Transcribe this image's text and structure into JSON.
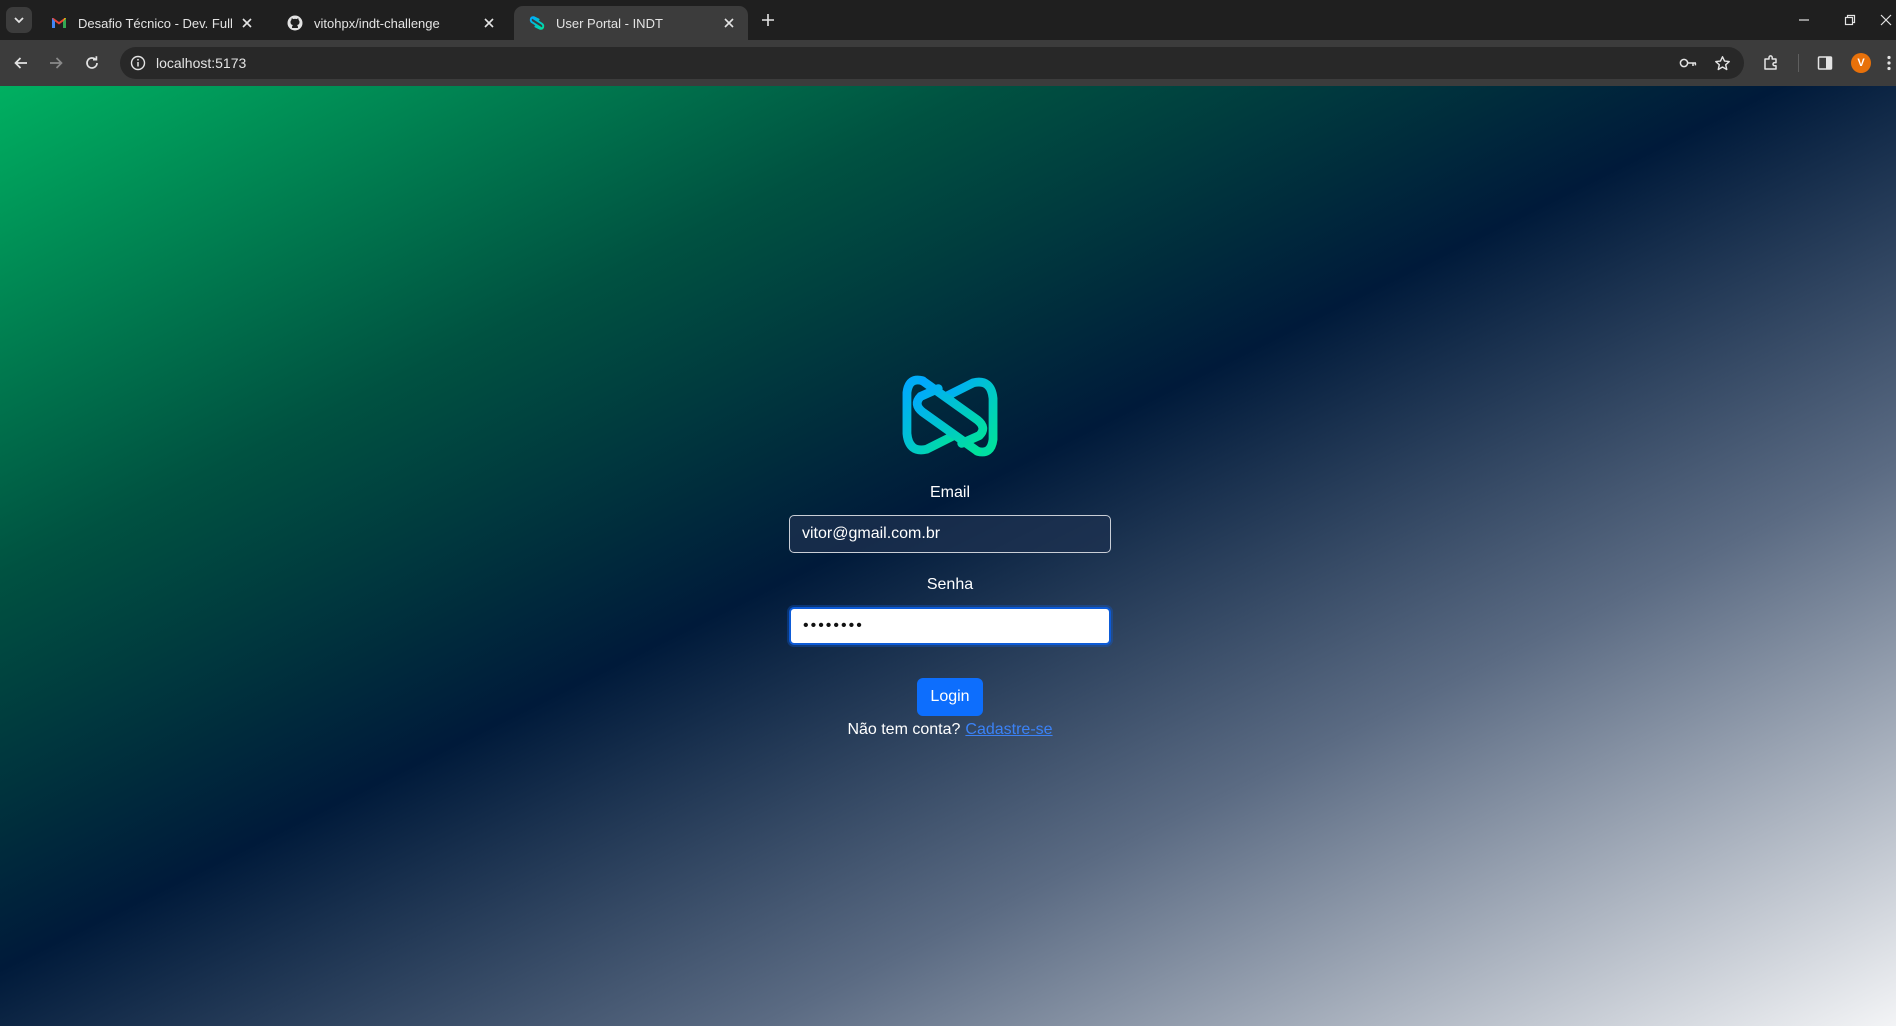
{
  "browser": {
    "tabs": [
      {
        "title": "Desafio Técnico - Dev. Full Stack",
        "favicon": "gmail-icon",
        "active": false
      },
      {
        "title": "vitohpx/indt-challenge",
        "favicon": "github-icon",
        "active": false
      },
      {
        "title": "User Portal - INDT",
        "favicon": "indt-logo-icon",
        "active": true
      }
    ],
    "url": "localhost:5173",
    "profile_initial": "V"
  },
  "login": {
    "email_label": "Email",
    "email_value": "vitor@gmail.com.br",
    "password_label": "Senha",
    "password_value": "••••••••",
    "login_button": "Login",
    "signup_prompt": "Não tem conta?",
    "signup_link": "Cadastre-se"
  },
  "colors": {
    "accent": "#0d6efd",
    "link": "#3b82f6",
    "gradient_start": "#00b061",
    "gradient_mid": "#001a3a",
    "gradient_end": "#f3f4f6"
  }
}
